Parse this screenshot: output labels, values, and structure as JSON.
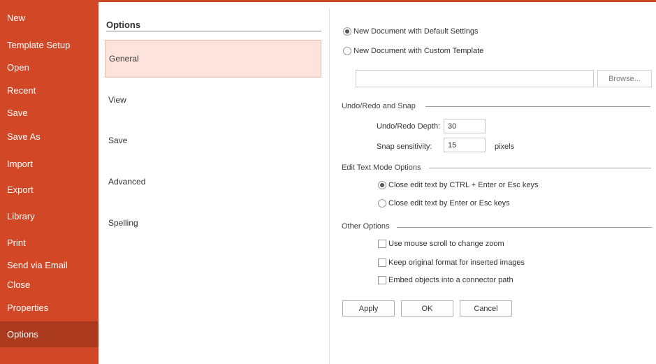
{
  "sidebar": {
    "items": [
      {
        "label": "New"
      },
      {
        "label": "Template Setup"
      },
      {
        "label": "Open"
      },
      {
        "label": "Recent"
      },
      {
        "label": "Save"
      },
      {
        "label": "Save As"
      },
      {
        "label": "Import"
      },
      {
        "label": "Export"
      },
      {
        "label": "Library"
      },
      {
        "label": "Print"
      },
      {
        "label": "Send via Email"
      },
      {
        "label": "Close"
      },
      {
        "label": "Properties"
      },
      {
        "label": "Options"
      }
    ],
    "active": "Options",
    "color": "#d24726"
  },
  "options": {
    "title": "Options",
    "categories": [
      {
        "label": "General",
        "selected": true
      },
      {
        "label": "View"
      },
      {
        "label": "Save"
      },
      {
        "label": "Advanced"
      },
      {
        "label": "Spelling"
      }
    ]
  },
  "general": {
    "new_doc_default": "New Document with Default Settings",
    "new_doc_custom": "New Document with Custom Template",
    "template_path": "",
    "browse_label": "Browse...",
    "undo_group": "Undo/Redo and Snap",
    "undo_depth_label": "Undo/Redo Depth:",
    "undo_depth_value": "30",
    "snap_label": "Snap sensitivity:",
    "snap_value": "15",
    "snap_unit": "pixels",
    "edit_group": "Edit Text Mode Options",
    "edit_opt1": "Close edit text by CTRL + Enter or Esc keys",
    "edit_opt2": "Close edit text by Enter or Esc keys",
    "other_group": "Other Options",
    "other_opt1": "Use mouse scroll to change zoom",
    "other_opt2": "Keep original format for inserted images",
    "other_opt3": "Embed objects into a connector path",
    "apply_label": "Apply",
    "ok_label": "OK",
    "cancel_label": "Cancel"
  }
}
